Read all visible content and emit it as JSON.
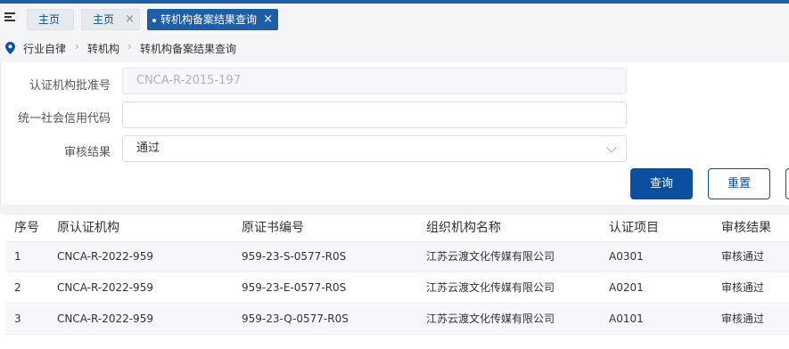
{
  "tabs": [
    {
      "label": "主页",
      "closable": false
    },
    {
      "label": "主页",
      "closable": true
    },
    {
      "label": "转机构备案结果查询",
      "closable": true,
      "active": true
    }
  ],
  "breadcrumb": [
    "行业自律",
    "转机构",
    "转机构备案结果查询"
  ],
  "form": {
    "approval_label": "认证机构批准号",
    "approval_value": "CNCA-R-2015-197",
    "credit_label": "统一社会信用代码",
    "credit_value": "",
    "result_label": "审核结果",
    "result_value": "通过"
  },
  "buttons": {
    "query": "查询",
    "reset": "重置"
  },
  "table": {
    "headers": [
      "序号",
      "原认证机构",
      "原证书编号",
      "组织机构名称",
      "认证项目",
      "审核结果"
    ],
    "rows": [
      [
        "1",
        "CNCA-R-2022-959",
        "959-23-S-0577-R0S",
        "江苏云渡文化传媒有限公司",
        "A0301",
        "审核通过"
      ],
      [
        "2",
        "CNCA-R-2022-959",
        "959-23-E-0577-R0S",
        "江苏云渡文化传媒有限公司",
        "A0201",
        "审核通过"
      ],
      [
        "3",
        "CNCA-R-2022-959",
        "959-23-Q-0577-R0S",
        "江苏云渡文化传媒有限公司",
        "A0101",
        "审核通过"
      ]
    ]
  },
  "colors": {
    "primary": "#0b4fa0",
    "topbar": "#1c5ea8"
  }
}
